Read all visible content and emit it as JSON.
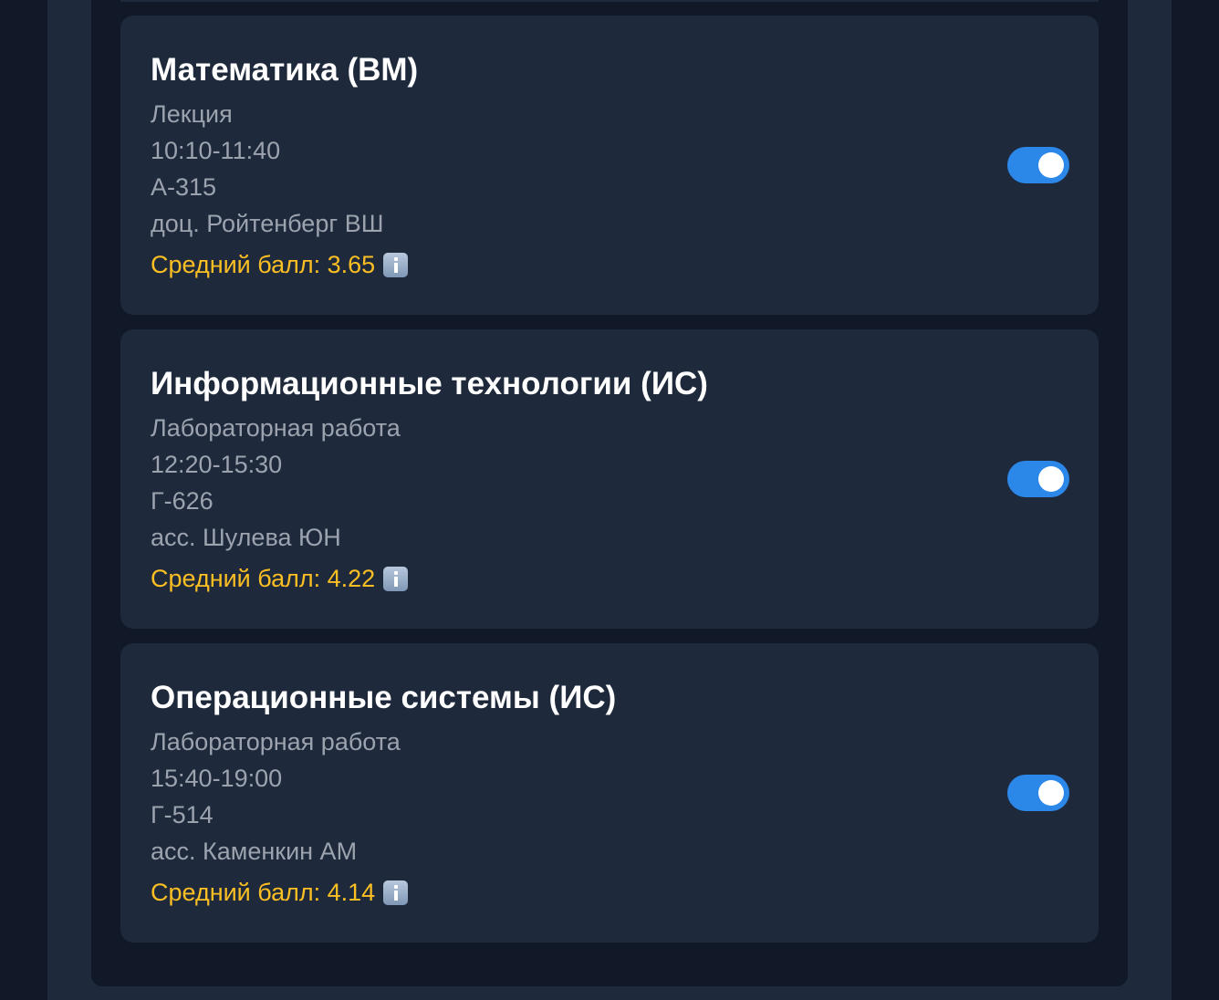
{
  "accent_color": "#2b87e8",
  "rating_color": "#fbbf24",
  "classes": [
    {
      "title": "Математика (ВМ)",
      "type": "Лекция",
      "time": "10:10-11:40",
      "room": "А-315",
      "teacher": "доц. Ройтенберг ВШ",
      "rating": "Средний балл: 3.65",
      "rating_icon": "info-icon",
      "enabled": true
    },
    {
      "title": "Информационные технологии (ИС)",
      "type": "Лабораторная работа",
      "time": "12:20-15:30",
      "room": "Г-626",
      "teacher": "асс. Шулева ЮН",
      "rating": "Средний балл: 4.22",
      "rating_icon": "info-icon",
      "enabled": true
    },
    {
      "title": "Операционные системы (ИС)",
      "type": "Лабораторная работа",
      "time": "15:40-19:00",
      "room": "Г-514",
      "teacher": "асс. Каменкин АМ",
      "rating": "Средний балл: 4.14",
      "rating_icon": "info-icon",
      "enabled": true
    }
  ]
}
